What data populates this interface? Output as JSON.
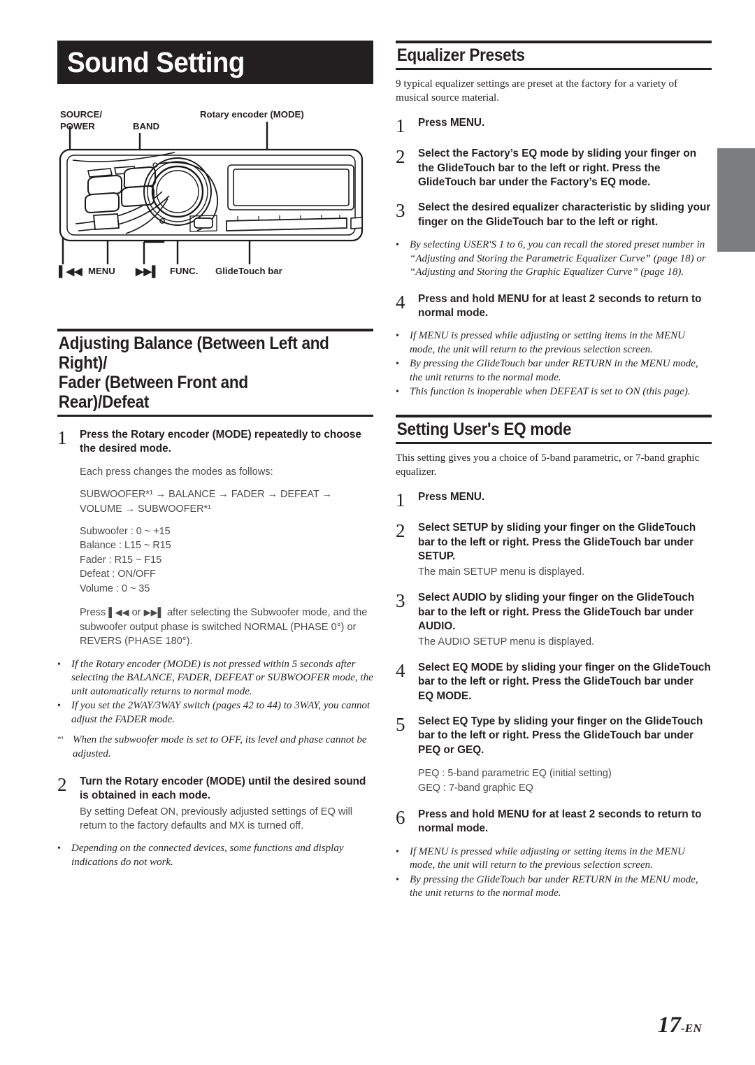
{
  "chapter": {
    "title": "Sound Setting"
  },
  "diagram": {
    "labels": {
      "source_power": "SOURCE/\nPOWER",
      "band": "BAND",
      "rotary_encoder": "Rotary encoder (MODE)",
      "prev_track": "▶▶◀◀",
      "menu": "MENU",
      "next_track": "▶▶▶",
      "func": "FUNC.",
      "glidetouch_bar": "GlideTouch bar"
    }
  },
  "left": {
    "section": {
      "heading": "Adjusting Balance (Between Left and Right)/ Fader (Between Front and Rear)/Defeat",
      "heading_line1": "Adjusting Balance (Between Left and Right)/",
      "heading_line2": "Fader (Between Front and Rear)/Defeat"
    },
    "step1": {
      "num": "1",
      "text_pre": "Press the ",
      "text_bold": "Rotary encoder (MODE)",
      "text_post": " repeatedly to choose the desired mode."
    },
    "each_press": "Each press changes the modes as follows:",
    "mode_flow_line1": "SUBWOOFER*¹ → BALANCE → FADER → DEFEAT →",
    "mode_flow_line2": "VOLUME → SUBWOOFER*¹",
    "ranges": [
      "Subwoofer : 0 ~ +15",
      "Balance : L15 ~ R15",
      "Fader : R15 ~ F15",
      "Defeat : ON/OFF",
      "Volume : 0 ~ 35"
    ],
    "phase_note_pre": "Press ",
    "phase_note_icon1": "◀◀▏",
    "phase_note_mid": " or ",
    "phase_note_icon2": "▏▶▶",
    "phase_note_post": " after selecting the Subwoofer mode, and the subwoofer output phase is switched NORMAL (PHASE 0°) or REVERS (PHASE 180°).",
    "notes_1": [
      "If the Rotary encoder (MODE) is not pressed within 5 seconds after selecting the BALANCE, FADER, DEFEAT or SUBWOOFER mode, the unit automatically returns to normal mode.",
      "If you set the 2WAY/3WAY switch (pages 42 to 44) to 3WAY, you cannot adjust the FADER mode."
    ],
    "footnote_marker": "*¹",
    "footnote_text": "When the subwoofer mode is set to OFF, its level and phase cannot be adjusted.",
    "step2": {
      "num": "2",
      "text_pre": "Turn the ",
      "text_bold": "Rotary encoder (MODE)",
      "text_post": " until the desired sound is obtained in each mode."
    },
    "step2_sub": "By setting Defeat ON, previously adjusted settings of EQ will return to the factory defaults and MX is turned off.",
    "notes_2": [
      "Depending on the connected devices, some functions and display indications do not work."
    ]
  },
  "right": {
    "eq_presets": {
      "heading": "Equalizer Presets",
      "intro": "9 typical equalizer settings are preset at the factory for a variety of musical source material.",
      "step1": {
        "num": "1",
        "pre": "Press ",
        "bold": "MENU",
        "post": "."
      },
      "step2": {
        "num": "2",
        "p1": "Select the Factory’s EQ mode by sliding your finger on the ",
        "b1": "GlideTouch bar",
        "p2": " to the left or right. Press the ",
        "b2": "GlideTouch bar",
        "p3": " under the Factory’s EQ mode."
      },
      "step3": {
        "num": "3",
        "p1": "Select the desired equalizer characteristic by sliding your finger on the ",
        "b1": "GlideTouch bar",
        "p2": " to the left or right."
      },
      "note_after_3": "By selecting USER'S 1 to 6, you can recall the stored preset number in “Adjusting and Storing the Parametric Equalizer Curve” (page 18) or “Adjusting and Storing the Graphic Equalizer Curve” (page 18).",
      "step4": {
        "num": "4",
        "p1": "Press and hold ",
        "b1": "MENU",
        "p2": " for at least 2 seconds to return to normal mode."
      },
      "notes": [
        "If MENU is pressed while adjusting or setting items in the MENU mode, the unit will return to the previous selection screen.",
        "By pressing the GlideTouch bar under RETURN in the MENU mode, the unit returns to the normal mode.",
        "This function is inoperable when DEFEAT is set to ON (this page)."
      ]
    },
    "users_eq": {
      "heading": "Setting User's EQ mode",
      "intro": "This setting gives you a choice of 5-band parametric, or 7-band graphic equalizer.",
      "step1": {
        "num": "1",
        "pre": "Press ",
        "bold": "MENU",
        "post": "."
      },
      "step2": {
        "num": "2",
        "p1": "Select SETUP by sliding your finger on the ",
        "b1": "GlideTouch bar",
        "p2": " to the left or right. Press the ",
        "b2": "GlideTouch bar",
        "p3": " under SETUP.",
        "sub": "The main SETUP menu is displayed."
      },
      "step3": {
        "num": "3",
        "p1": "Select AUDIO by sliding your finger on the ",
        "b1": "GlideTouch bar",
        "p2": " to the left or right. Press the ",
        "b2": "GlideTouch bar",
        "p3": " under AUDIO.",
        "sub": "The AUDIO SETUP menu is displayed."
      },
      "step4": {
        "num": "4",
        "p1": "Select EQ MODE by sliding your finger on the ",
        "b1": "GlideTouch bar",
        "p2": " to the left or right. Press the ",
        "b2": "GlideTouch bar",
        "p3": " under EQ MODE."
      },
      "step5": {
        "num": "5",
        "p1": "Select EQ Type by sliding your finger on the ",
        "b1": "GlideTouch bar",
        "p2": " to the left or right. Press the ",
        "b2": "GlideTouch bar",
        "p3": " under PEQ or GEQ."
      },
      "eq_types": [
        "PEQ : 5-band parametric EQ (initial setting)",
        "GEQ : 7-band graphic EQ"
      ],
      "step6": {
        "num": "6",
        "p1": "Press and hold ",
        "b1": "MENU",
        "p2": " for at least 2 seconds to return to normal mode."
      },
      "notes": [
        "If MENU is pressed while adjusting or setting items in the MENU mode, the unit will return to the previous selection screen.",
        "By pressing the GlideTouch bar under RETURN in the MENU mode, the unit returns to the normal mode."
      ]
    }
  },
  "footer": {
    "page_number": "17",
    "lang": "-EN"
  }
}
